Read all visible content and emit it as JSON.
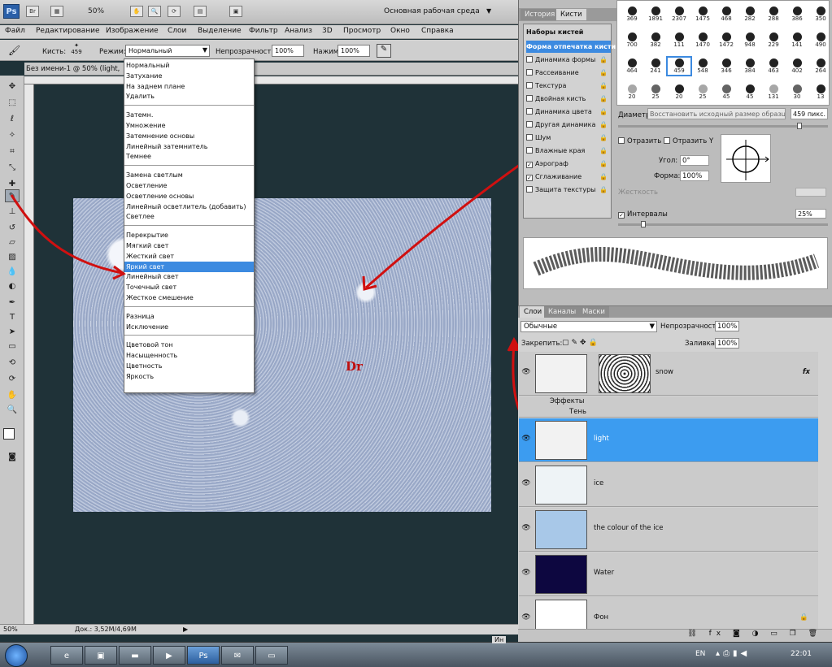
{
  "app": {
    "logo": "Ps",
    "zoom": "50%",
    "workspace": "Основная рабочая среда"
  },
  "menu": [
    "Файл",
    "Редактирование",
    "Изображение",
    "Слои",
    "Выделение",
    "Фильтр",
    "Анализ",
    "3D",
    "Просмотр",
    "Окно",
    "Справка"
  ],
  "options": {
    "brush_label": "Кисть:",
    "brush_size": "459",
    "mode_label": "Режим:",
    "mode_value": "Нормальный",
    "opacity_label": "Непрозрачность:",
    "opacity_value": "100%",
    "flow_label": "Нажим:",
    "flow_value": "100%"
  },
  "document": {
    "tab_title": "Без имени-1 @ 50% (light, ",
    "stamp": "Dr",
    "status_zoom": "50%",
    "status_doc": "Док.: 3,52M/4,69M"
  },
  "blend_modes": {
    "groups": [
      [
        "Нормальный",
        "Затухание",
        "На заднем плане",
        "Удалить"
      ],
      [
        "Затемн.",
        "Умножение",
        "Затемнение основы",
        "Линейный затемнитель",
        "Темнее"
      ],
      [
        "Замена светлым",
        "Осветление",
        "Осветление основы",
        "Линейный осветлитель (добавить)",
        "Светлее"
      ],
      [
        "Перекрытие",
        "Мягкий свет",
        "Жесткий свет",
        "Яркий свет",
        "Линейный свет",
        "Точечный свет",
        "Жесткое смешение"
      ],
      [
        "Разница",
        "Исключение"
      ],
      [
        "Цветовой тон",
        "Насыщенность",
        "Цветность",
        "Яркость"
      ]
    ],
    "highlighted": "Яркий свет"
  },
  "brush_panel": {
    "tabs": [
      "История",
      "Кисти"
    ],
    "presets_title": "Наборы кистей",
    "items": [
      {
        "label": "Форма отпечатка кисти",
        "checked": null,
        "selected": true
      },
      {
        "label": "Динамика формы",
        "checked": false
      },
      {
        "label": "Рассеивание",
        "checked": false
      },
      {
        "label": "Текстура",
        "checked": false
      },
      {
        "label": "Двойная кисть",
        "checked": false
      },
      {
        "label": "Динамика цвета",
        "checked": false
      },
      {
        "label": "Другая динамика",
        "checked": false
      },
      {
        "label": "Шум",
        "checked": false
      },
      {
        "label": "Влажные края",
        "checked": false
      },
      {
        "label": "Аэрограф",
        "checked": true
      },
      {
        "label": "Сглаживание",
        "checked": true
      },
      {
        "label": "Защита текстуры",
        "checked": false
      }
    ],
    "preset_sizes": [
      [
        "369",
        "1891",
        "2307",
        "1475",
        "468",
        "282",
        "288",
        "386",
        "350"
      ],
      [
        "700",
        "382",
        "111",
        "1470",
        "1472",
        "948",
        "229",
        "141",
        "490"
      ],
      [
        "464",
        "241",
        "459",
        "548",
        "346",
        "384",
        "463",
        "402",
        "264"
      ],
      [
        "20",
        "25",
        "20",
        "25",
        "45",
        "45",
        "131",
        "30",
        "13"
      ]
    ],
    "selected_preset": "459",
    "diameter_label": "Диаметр",
    "restore_button": "Восстановить исходный размер образца",
    "diameter_value": "459 пикс.",
    "flip_x": "Отразить X",
    "flip_y": "Отразить Y",
    "angle_label": "Угол:",
    "angle_value": "0°",
    "roundness_label": "Форма:",
    "roundness_value": "100%",
    "hardness_label": "Жесткость",
    "spacing_label": "Интервалы",
    "spacing_value": "25%"
  },
  "layers_panel": {
    "tabs": [
      "Слои",
      "Каналы",
      "Маски"
    ],
    "blend_value": "Обычные",
    "opacity_label": "Непрозрачность:",
    "opacity_value": "100%",
    "lock_label": "Закрепить:",
    "fill_label": "Заливка:",
    "fill_value": "100%",
    "effects_label": "Эффекты",
    "shadow_label": "Тень",
    "layers": [
      {
        "name": "snow",
        "fx": "fx",
        "thumb": "#f2f2f2"
      },
      {
        "name": "light",
        "selected": true,
        "thumb": "#f2f2f2"
      },
      {
        "name": "ice",
        "thumb": "#eef3f6"
      },
      {
        "name": "the colour of the ice",
        "thumb": "#a8c8e8"
      },
      {
        "name": "Water",
        "thumb": "#0d0740"
      },
      {
        "name": "Фон",
        "thumb": "#ffffff"
      }
    ]
  },
  "taskbar": {
    "lang": "EN",
    "time": "22:01",
    "partial_label": "Ин"
  }
}
